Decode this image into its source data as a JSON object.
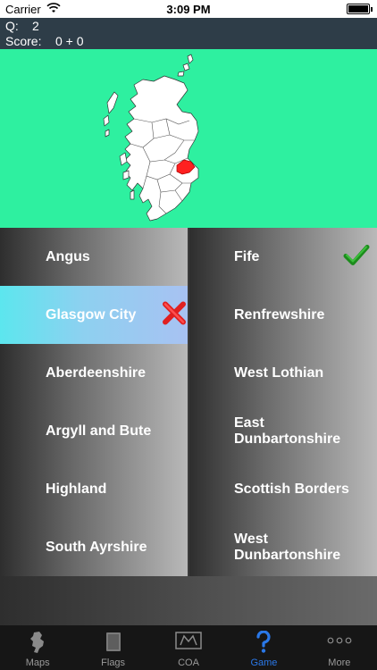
{
  "status_bar": {
    "carrier": "Carrier",
    "time": "3:09 PM"
  },
  "header": {
    "question_label": "Q:",
    "question_value": "2",
    "score_label": "Score:",
    "score_value": "0 + 0"
  },
  "map": {
    "background": "#2ef0a0",
    "highlight_color": "#ff2020"
  },
  "answers": {
    "left": [
      {
        "label": "Angus"
      },
      {
        "label": "Glasgow City",
        "state": "wrong"
      },
      {
        "label": "Aberdeenshire"
      },
      {
        "label": "Argyll and Bute"
      },
      {
        "label": "Highland"
      },
      {
        "label": "South Ayrshire"
      }
    ],
    "right": [
      {
        "label": "Fife",
        "state": "correct"
      },
      {
        "label": "Renfrewshire"
      },
      {
        "label": "West Lothian"
      },
      {
        "label": "East Dunbartonshire"
      },
      {
        "label": "Scottish Borders"
      },
      {
        "label": "West Dunbartonshire"
      }
    ]
  },
  "tabs": [
    {
      "label": "Maps",
      "icon": "scotland-map-icon"
    },
    {
      "label": "Flags",
      "icon": "flag-icon"
    },
    {
      "label": "COA",
      "icon": "coat-of-arms-icon"
    },
    {
      "label": "Game",
      "icon": "question-mark-icon",
      "active": true
    },
    {
      "label": "More",
      "icon": "more-dots-icon"
    }
  ]
}
